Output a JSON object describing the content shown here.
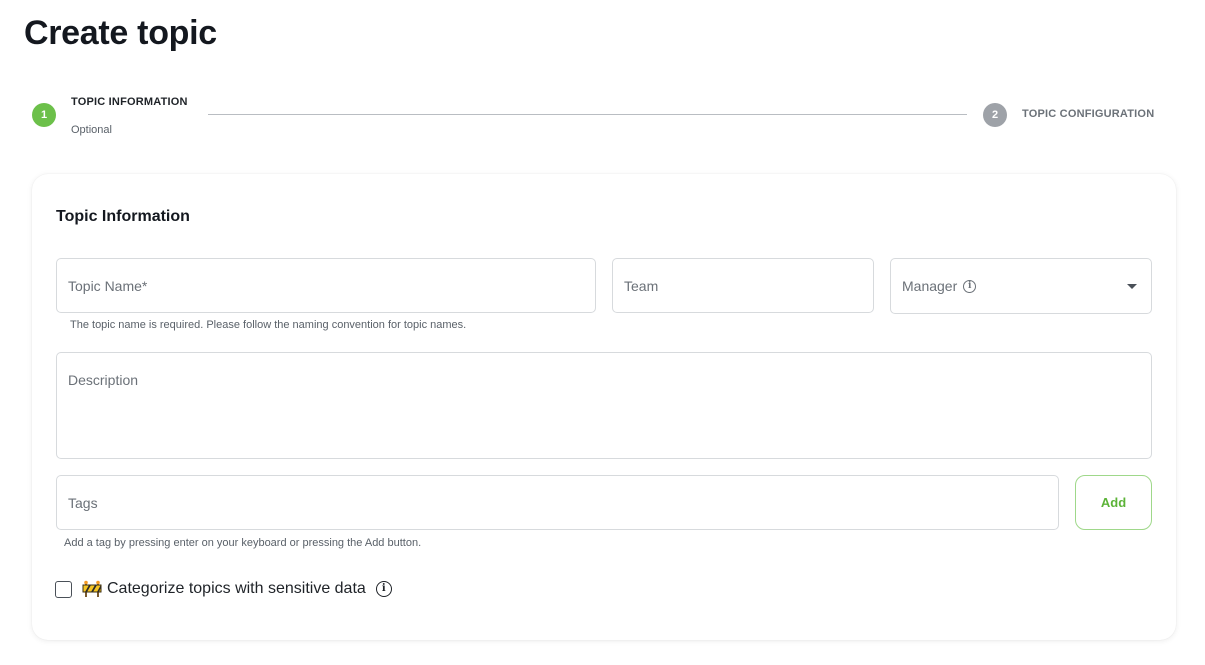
{
  "page": {
    "title": "Create topic"
  },
  "stepper": {
    "step1": {
      "number": "1",
      "label": "TOPIC INFORMATION",
      "sub": "Optional",
      "color": "#6cc04a"
    },
    "step2": {
      "number": "2",
      "label": "TOPIC CONFIGURATION",
      "color": "#9ea2a8"
    }
  },
  "form": {
    "section_title": "Topic Information",
    "topic_name": {
      "placeholder": "Topic Name*",
      "value": "",
      "helper": "The topic name is required. Please follow the naming convention for topic names."
    },
    "team": {
      "placeholder": "Team",
      "value": ""
    },
    "manager": {
      "label": "Manager",
      "info_icon": "i"
    },
    "description": {
      "placeholder": "Description",
      "value": ""
    },
    "tags": {
      "placeholder": "Tags",
      "value": "",
      "helper": "Add a tag by pressing enter on your keyboard or pressing the Add button."
    },
    "add_button": {
      "label": "Add",
      "color": "#5cb338"
    },
    "sensitive": {
      "label": "Categorize topics with sensitive data",
      "icon": "construction-barrier-icon",
      "info_icon": "i",
      "checked": false
    }
  }
}
